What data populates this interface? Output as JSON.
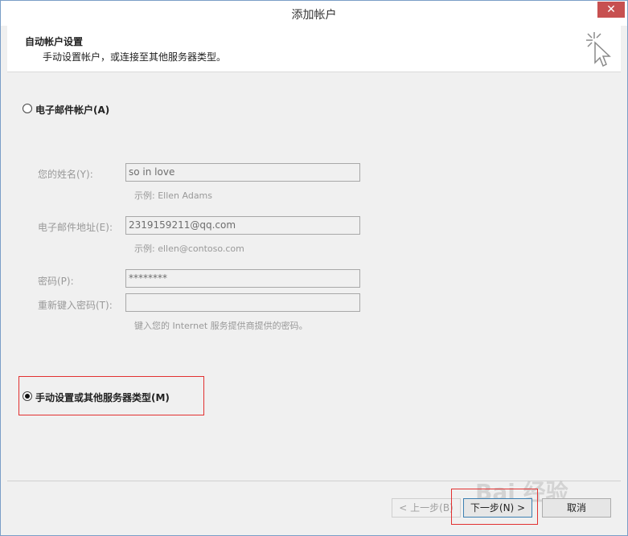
{
  "window": {
    "title": "添加帐户",
    "close_label": "✕"
  },
  "header": {
    "title": "自动帐户设置",
    "subtitle": "手动设置帐户，或连接至其他服务器类型。",
    "icon": "cursor-sparkle-icon"
  },
  "options": {
    "email_account": {
      "label": "电子邮件帐户(A)",
      "checked": false
    },
    "manual_setup": {
      "label": "手动设置或其他服务器类型(M)",
      "checked": true
    }
  },
  "form": {
    "name": {
      "label": "您的姓名(Y):",
      "value": "so in love",
      "hint": "示例: Ellen Adams"
    },
    "email": {
      "label": "电子邮件地址(E):",
      "value": "2319159211@qq.com",
      "hint": "示例: ellen@contoso.com"
    },
    "password": {
      "label": "密码(P):",
      "value": "********"
    },
    "retype_password": {
      "label": "重新键入密码(T):",
      "value": ""
    },
    "password_hint": "键入您的 Internet 服务提供商提供的密码。"
  },
  "buttons": {
    "back": "< 上一步(B)",
    "next": "下一步(N) >",
    "cancel": "取消"
  },
  "watermark": "Bai 经验"
}
